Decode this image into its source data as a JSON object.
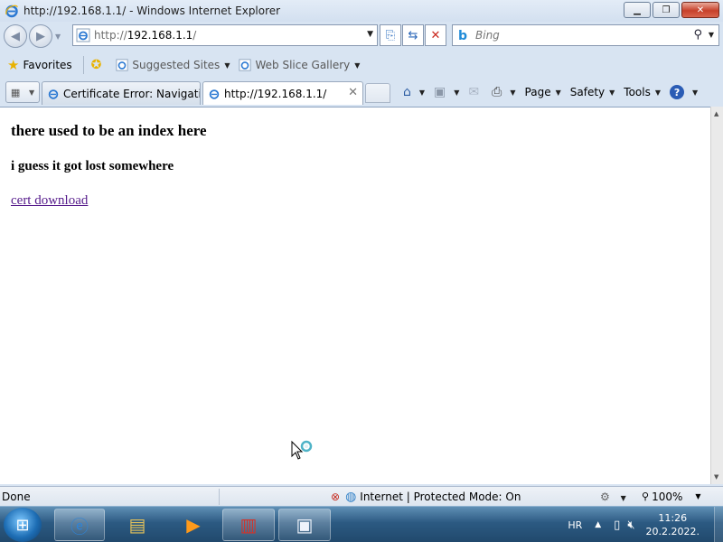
{
  "window": {
    "title": "http://192.168.1.1/ - Windows Internet Explorer",
    "minimize_label": "▁",
    "maximize_label": "❐",
    "close_label": "✕"
  },
  "address": {
    "url_prefix": "http://",
    "url_host": "192.168.1.1",
    "url_suffix": "/"
  },
  "search": {
    "placeholder": "Bing",
    "provider_icon": "bing-icon"
  },
  "favorites": {
    "label": "Favorites",
    "items": [
      {
        "label": "Suggested Sites"
      },
      {
        "label": "Web Slice Gallery"
      }
    ]
  },
  "tabs": [
    {
      "label": "Certificate Error: Navigatio...",
      "active": false
    },
    {
      "label": "http://192.168.1.1/",
      "active": true
    }
  ],
  "commands": {
    "page": "Page",
    "safety": "Safety",
    "tools": "Tools"
  },
  "content": {
    "heading": "there used to be an index here",
    "subheading": "i guess it got lost somewhere",
    "link": "cert download"
  },
  "status": {
    "text": "Done",
    "zone": "Internet | Protected Mode: On",
    "zoom": "100%"
  },
  "taskbar": {
    "language": "HR",
    "time": "11:26",
    "date": "20.2.2022."
  }
}
